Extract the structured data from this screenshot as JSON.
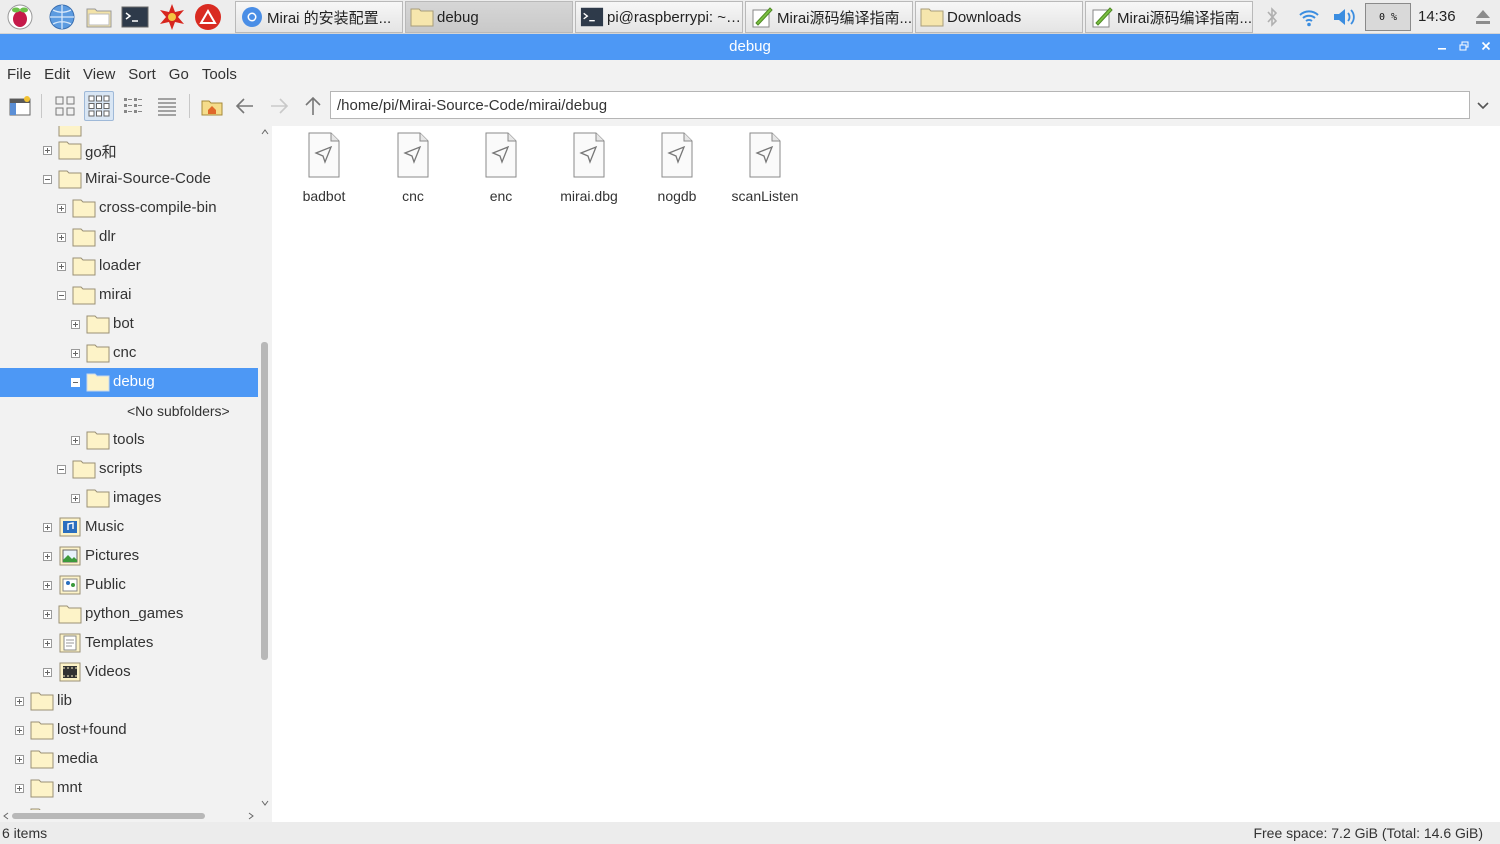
{
  "taskbar": {
    "launchers": [
      {
        "icon": "raspberry-menu-icon"
      },
      {
        "icon": "web-browser-icon"
      },
      {
        "icon": "file-manager-icon"
      },
      {
        "icon": "terminal-icon"
      },
      {
        "icon": "math-app-icon"
      },
      {
        "icon": "wolfram-icon"
      }
    ],
    "tasks": [
      {
        "icon": "browser-icon",
        "label": "Mirai 的安装配置..."
      },
      {
        "icon": "folder-icon",
        "label": "debug",
        "active": true
      },
      {
        "icon": "terminal-icon",
        "label": "pi@raspberrypi: ~/..."
      },
      {
        "icon": "text-editor-icon",
        "label": "Mirai源码编译指南..."
      },
      {
        "icon": "folder-icon",
        "label": "Downloads"
      },
      {
        "icon": "text-editor-icon",
        "label": "Mirai源码编译指南..."
      }
    ],
    "cpu_usage": "0 %",
    "clock": "14:36"
  },
  "window": {
    "title": "debug",
    "colors": {
      "accent": "#4d98f5",
      "selection": "#4d98f5"
    }
  },
  "menu": [
    "File",
    "Edit",
    "View",
    "Sort",
    "Go",
    "Tools"
  ],
  "toolbar": {
    "path": "/home/pi/Mirai-Source-Code/mirai/debug",
    "view_mode": "icon-view"
  },
  "tree": [
    {
      "label": "go和",
      "expander": "plus",
      "icon": "folder"
    },
    {
      "label": "Mirai-Source-Code",
      "expander": "minus",
      "icon": "folder"
    },
    {
      "label": "cross-compile-bin",
      "expander": "plus",
      "icon": "folder"
    },
    {
      "label": "dlr",
      "expander": "plus",
      "icon": "folder"
    },
    {
      "label": "loader",
      "expander": "plus",
      "icon": "folder"
    },
    {
      "label": "mirai",
      "expander": "minus",
      "icon": "folder"
    },
    {
      "label": "bot",
      "expander": "plus",
      "icon": "folder"
    },
    {
      "label": "cnc",
      "expander": "plus",
      "icon": "folder"
    },
    {
      "label": "debug",
      "expander": "minus",
      "icon": "folder",
      "selected": true
    },
    {
      "label": "<No subfolders>",
      "placeholder": true
    },
    {
      "label": "tools",
      "expander": "plus",
      "icon": "folder"
    },
    {
      "label": "scripts",
      "expander": "minus",
      "icon": "folder"
    },
    {
      "label": "images",
      "expander": "plus",
      "icon": "folder"
    },
    {
      "label": "Music",
      "expander": "plus",
      "icon": "music-folder"
    },
    {
      "label": "Pictures",
      "expander": "plus",
      "icon": "pictures-folder"
    },
    {
      "label": "Public",
      "expander": "plus",
      "icon": "public-folder"
    },
    {
      "label": "python_games",
      "expander": "plus",
      "icon": "folder"
    },
    {
      "label": "Templates",
      "expander": "plus",
      "icon": "templates-folder"
    },
    {
      "label": "Videos",
      "expander": "plus",
      "icon": "videos-folder"
    },
    {
      "label": "lib",
      "expander": "plus",
      "icon": "folder"
    },
    {
      "label": "lost+found",
      "expander": "plus",
      "icon": "folder"
    },
    {
      "label": "media",
      "expander": "plus",
      "icon": "folder"
    },
    {
      "label": "mnt",
      "expander": "plus",
      "icon": "folder"
    }
  ],
  "files": [
    {
      "name": "badbot",
      "icon": "executable-file-icon"
    },
    {
      "name": "cnc",
      "icon": "executable-file-icon"
    },
    {
      "name": "enc",
      "icon": "executable-file-icon"
    },
    {
      "name": "mirai.dbg",
      "icon": "executable-file-icon"
    },
    {
      "name": "nogdb",
      "icon": "executable-file-icon"
    },
    {
      "name": "scanListen",
      "icon": "executable-file-icon"
    }
  ],
  "status": {
    "items": "6 items",
    "free_space": "Free space: 7.2 GiB (Total: 14.6 GiB)"
  }
}
